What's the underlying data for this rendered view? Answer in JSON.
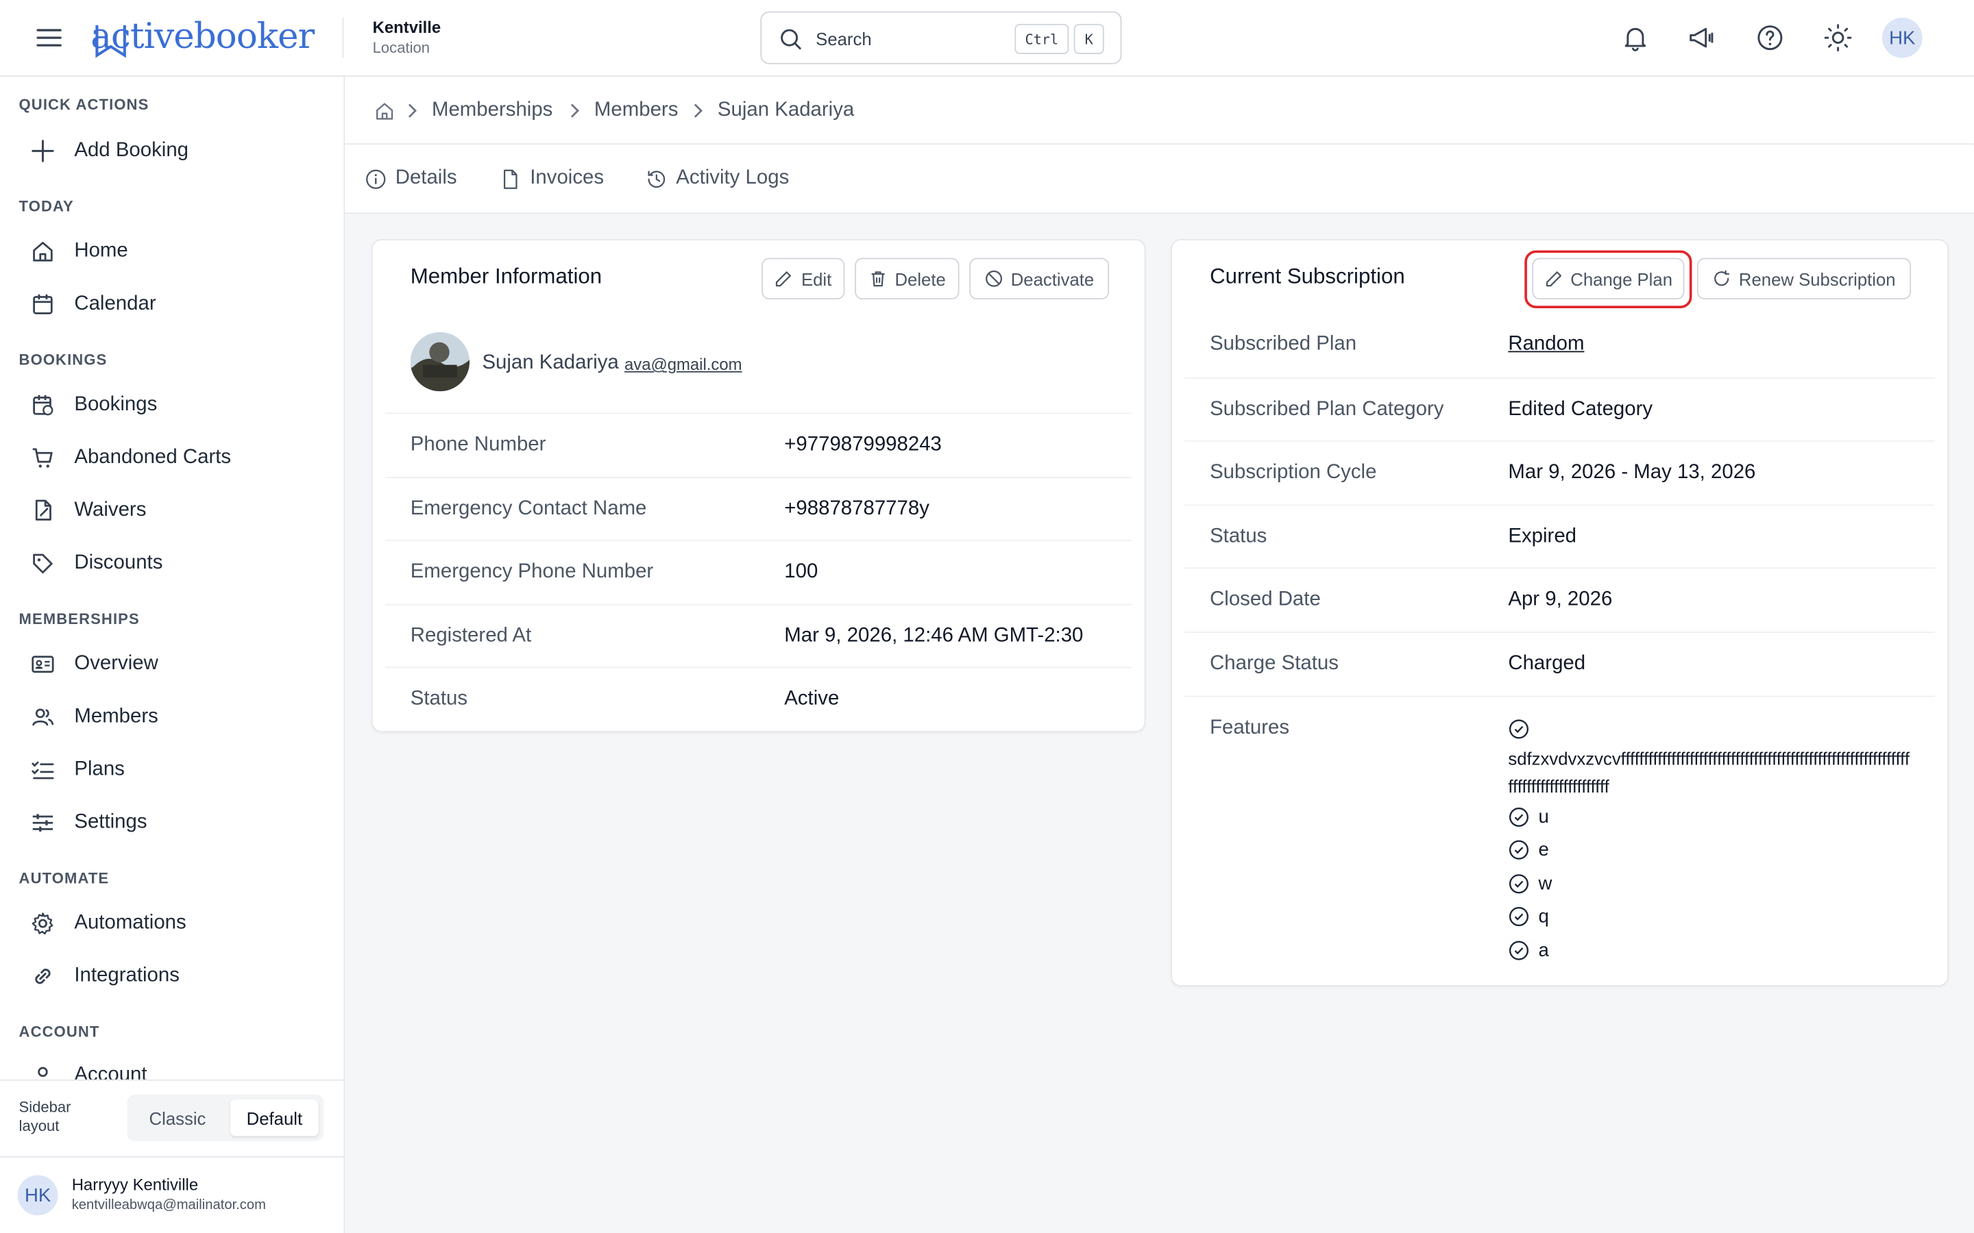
{
  "header": {
    "brand": "activebooker",
    "location_name": "Kentville",
    "location_sub": "Location",
    "search_placeholder": "Search",
    "kbd_ctrl": "Ctrl",
    "kbd_k": "K",
    "avatar_initials": "HK"
  },
  "sidebar": {
    "sections": {
      "quick_actions": "QUICK ACTIONS",
      "today": "TODAY",
      "bookings": "BOOKINGS",
      "memberships": "MEMBERSHIPS",
      "automate": "AUTOMATE",
      "account": "ACCOUNT"
    },
    "items": {
      "add_booking": "Add Booking",
      "home": "Home",
      "calendar": "Calendar",
      "bookings": "Bookings",
      "abandoned_carts": "Abandoned Carts",
      "waivers": "Waivers",
      "discounts": "Discounts",
      "overview": "Overview",
      "members": "Members",
      "plans": "Plans",
      "settings": "Settings",
      "automations": "Automations",
      "integrations": "Integrations",
      "account": "Account"
    },
    "layout_label_1": "Sidebar",
    "layout_label_2": "layout",
    "layout_classic": "Classic",
    "layout_default": "Default",
    "user_initials": "HK",
    "user_name": "Harryyy Kentiville",
    "user_email": "kentvilleabwqa@mailinator.com"
  },
  "breadcrumb": {
    "memberships": "Memberships",
    "members": "Members",
    "current": "Sujan Kadariya"
  },
  "tabs": {
    "details": "Details",
    "invoices": "Invoices",
    "activity_logs": "Activity Logs"
  },
  "member_info": {
    "title": "Member Information",
    "edit": "Edit",
    "delete": "Delete",
    "deactivate": "Deactivate",
    "name": "Sujan Kadariya",
    "email": "ava@gmail.com",
    "rows": [
      {
        "label": "Phone Number",
        "value": "+9779879998243"
      },
      {
        "label": "Emergency Contact Name",
        "value": "+98878787778y"
      },
      {
        "label": "Emergency Phone Number",
        "value": "100"
      },
      {
        "label": "Registered At",
        "value": "Mar 9, 2026, 12:46 AM GMT-2:30"
      },
      {
        "label": "Status",
        "value": "Active"
      }
    ]
  },
  "subscription": {
    "title": "Current Subscription",
    "change_plan": "Change Plan",
    "renew": "Renew Subscription",
    "rows": [
      {
        "label": "Subscribed Plan",
        "value": "Random"
      },
      {
        "label": "Subscribed Plan Category",
        "value": "Edited Category"
      },
      {
        "label": "Subscription Cycle",
        "value": "Mar 9, 2026 - May 13, 2026"
      },
      {
        "label": "Status",
        "value": "Expired"
      },
      {
        "label": "Closed Date",
        "value": "Apr 9, 2026"
      },
      {
        "label": "Charge Status",
        "value": "Charged"
      }
    ],
    "features_label": "Features",
    "features": [
      "sdfzxvdvxzvcvfffffffffffffffffffffffffffffffffffffffffffffffffffffffffffffffffffffffffffffffffffff",
      "u",
      "e",
      "w",
      "q",
      "a"
    ]
  }
}
